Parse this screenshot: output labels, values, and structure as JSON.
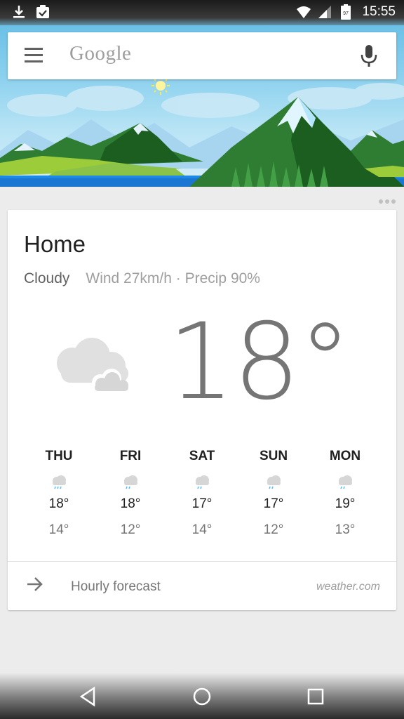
{
  "status_bar": {
    "time": "15:55",
    "battery_level": "97",
    "icons": [
      "download-icon",
      "clipboard-check-icon",
      "wifi-icon",
      "signal-icon",
      "battery-icon"
    ]
  },
  "search": {
    "logo_text": "Google",
    "icons": [
      "menu-icon",
      "mic-icon"
    ]
  },
  "weather": {
    "location": "Home",
    "condition": "Cloudy",
    "details": "Wind 27km/h · Precip 90%",
    "temperature": "18°",
    "main_icon": "cloudy-icon",
    "forecast": [
      {
        "day": "THU",
        "high": "18°",
        "low": "14°",
        "icon": "rain-cloud-icon"
      },
      {
        "day": "FRI",
        "high": "18°",
        "low": "12°",
        "icon": "rain-cloud-icon"
      },
      {
        "day": "SAT",
        "high": "17°",
        "low": "14°",
        "icon": "rain-cloud-icon"
      },
      {
        "day": "SUN",
        "high": "17°",
        "low": "12°",
        "icon": "rain-cloud-icon"
      },
      {
        "day": "MON",
        "high": "19°",
        "low": "13°",
        "icon": "rain-cloud-icon"
      }
    ],
    "hourly_label": "Hourly forecast",
    "source": "weather.com"
  },
  "nav": {
    "icons": [
      "back-icon",
      "home-icon",
      "recents-icon"
    ]
  },
  "colors": {
    "sky": "#8ad0ee",
    "mountain_dark": "#1e7a3a",
    "mountain_light": "#43a047",
    "grass": "#9ccc3a",
    "water": "#1e88e5",
    "rain_icon": "#64b5f6"
  }
}
